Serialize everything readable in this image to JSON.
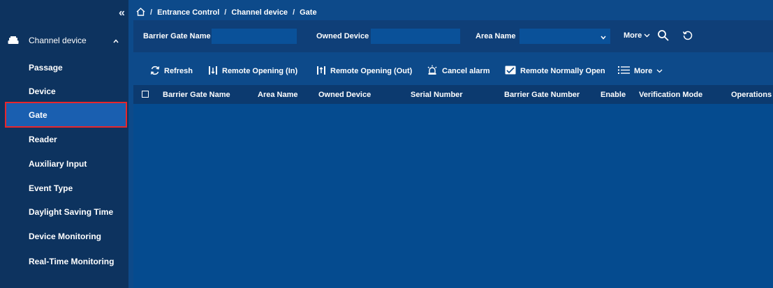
{
  "sidebar": {
    "collapse_glyph": "«",
    "group": {
      "label": "Channel device",
      "icon": "device-icon",
      "expanded": true
    },
    "items": [
      {
        "label": "Passage"
      },
      {
        "label": "Device"
      },
      {
        "label": "Gate",
        "active": true
      },
      {
        "label": "Reader"
      },
      {
        "label": "Auxiliary Input"
      },
      {
        "label": "Event Type"
      },
      {
        "label": "Daylight Saving Time"
      },
      {
        "label": "Device Monitoring"
      },
      {
        "label": "Real-Time Monitoring"
      }
    ]
  },
  "breadcrumb": {
    "home_icon": "home-icon",
    "separator": "/",
    "items": [
      "Entrance Control",
      "Channel device",
      "Gate"
    ]
  },
  "filters": {
    "barrier_gate_name": {
      "label": "Barrier Gate Name",
      "value": ""
    },
    "owned_device": {
      "label": "Owned Device",
      "value": ""
    },
    "area_name": {
      "label": "Area Name",
      "value": ""
    },
    "more_label": "More"
  },
  "toolbar": {
    "refresh": "Refresh",
    "remote_open_in": "Remote Opening (In)",
    "remote_open_out": "Remote Opening (Out)",
    "cancel_alarm": "Cancel alarm",
    "remote_normally_open": "Remote Normally Open",
    "more": "More"
  },
  "table": {
    "columns": [
      "Barrier Gate Name",
      "Area Name",
      "Owned Device",
      "Serial Number",
      "Barrier Gate Number",
      "Enable",
      "Verification Mode",
      "Operations"
    ],
    "rows": []
  },
  "colors": {
    "sidebar_bg": "#0d335f",
    "main_bg": "#0d4a8a",
    "active_item_bg": "#1a5fb0",
    "active_item_border": "#e8262b",
    "table_header_bg": "#0c3a6f",
    "table_body_bg": "#054b8f",
    "input_bg": "#0a5199"
  }
}
